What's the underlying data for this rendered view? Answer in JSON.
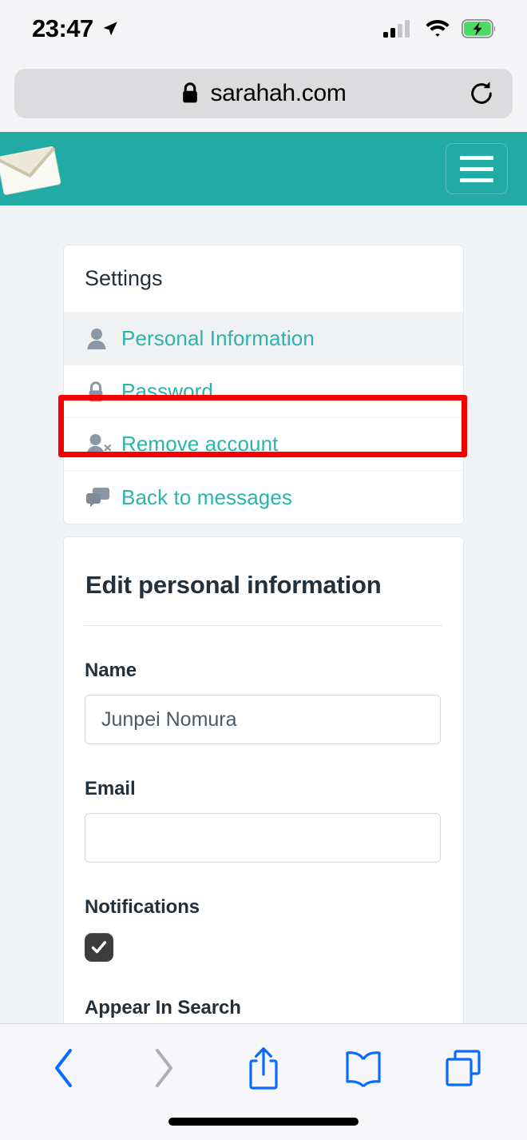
{
  "status_bar": {
    "time": "23:47",
    "location_icon": "location-arrow-icon",
    "signal_icon": "cellular-signal-icon",
    "wifi_icon": "wifi-icon",
    "battery_icon": "battery-charging-icon",
    "signal_bars_filled": 2,
    "signal_bars_total": 4,
    "battery_color": "#4cd964"
  },
  "browser": {
    "url": "sarahah.com",
    "lock_icon": "lock-icon",
    "reload_icon": "reload-icon"
  },
  "site_header": {
    "logo_icon": "envelope-logo-icon",
    "menu_icon": "hamburger-menu-icon",
    "background_color": "#22aba4"
  },
  "settings_card": {
    "title": "Settings",
    "items": [
      {
        "label": "Personal Information",
        "icon": "person-icon",
        "active": true
      },
      {
        "label": "Password",
        "icon": "lock-icon",
        "active": false
      },
      {
        "label": "Remove account",
        "icon": "person-remove-icon",
        "active": false
      },
      {
        "label": "Back to messages",
        "icon": "speech-bubbles-icon",
        "active": false
      }
    ],
    "link_color": "#2bb3ad"
  },
  "annotation": {
    "target": "Remove account",
    "color": "#f90000"
  },
  "form": {
    "title": "Edit personal information",
    "name_label": "Name",
    "name_value": "Junpei Nomura",
    "name_placeholder": "",
    "email_label": "Email",
    "email_value": "",
    "email_placeholder": "",
    "notifications_label": "Notifications",
    "notifications_checked": true,
    "appear_in_search_label": "Appear In Search"
  },
  "toolbar": {
    "back_icon": "chevron-left-icon",
    "forward_icon": "chevron-right-icon",
    "share_icon": "share-icon",
    "bookmarks_icon": "book-icon",
    "tabs_icon": "tabs-icon",
    "active_color": "#0a6cff",
    "disabled_color": "#b0b0b4"
  }
}
